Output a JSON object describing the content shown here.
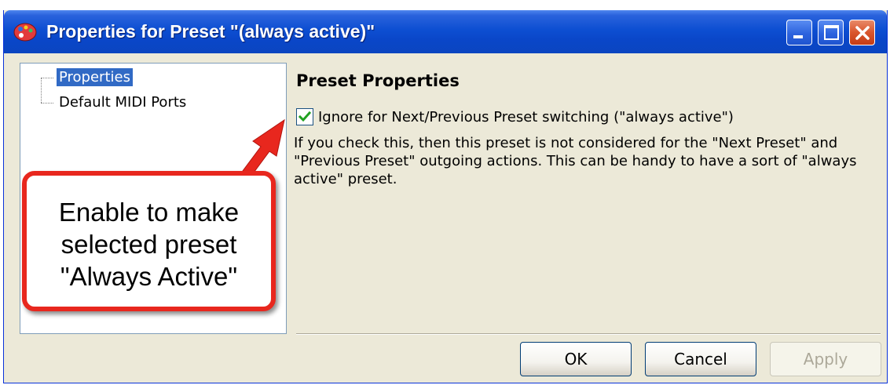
{
  "window": {
    "title": "Properties for Preset \"(always active)\"",
    "controls": [
      "minimize",
      "maximize",
      "close"
    ]
  },
  "tree": {
    "items": [
      {
        "label": "Properties",
        "selected": true
      },
      {
        "label": "Default MIDI Ports",
        "selected": false
      }
    ]
  },
  "panel": {
    "title": "Preset Properties",
    "checkbox": {
      "label": "Ignore for Next/Previous Preset switching (\"always active\")",
      "checked": true
    },
    "description": "If you check this, then this preset is not considered for the \"Next Preset\" and \"Previous Preset\" outgoing actions. This can be handy to have a sort of \"always active\" preset."
  },
  "buttons": {
    "ok": "OK",
    "cancel": "Cancel",
    "apply": "Apply"
  },
  "callout": {
    "lines": [
      "Enable to make",
      "selected preset",
      "\"Always Active\""
    ],
    "color": "#e8271e"
  },
  "colors": {
    "titlebar": "#0a46c8",
    "dialog_bg": "#ece9d8",
    "selection": "#316ac5"
  }
}
